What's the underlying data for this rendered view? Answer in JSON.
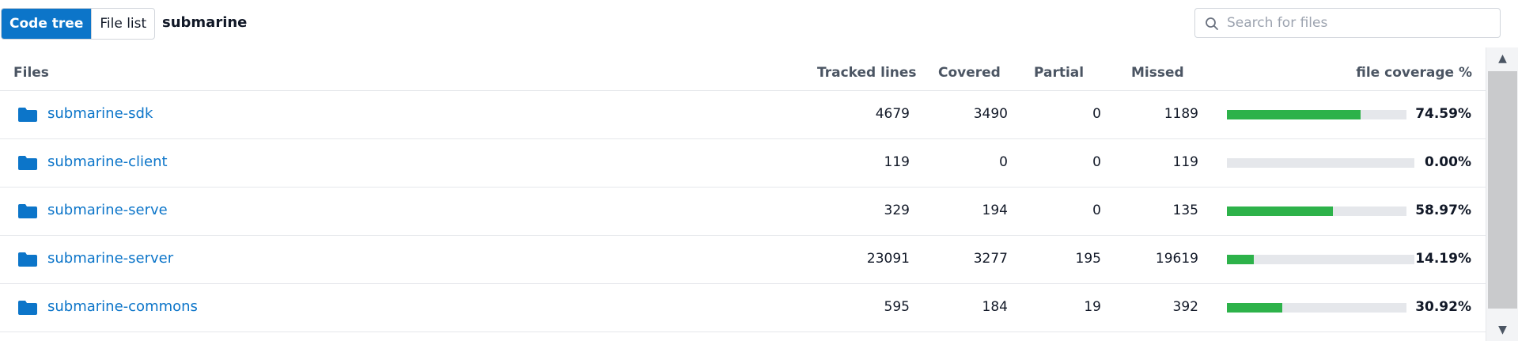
{
  "toolbar": {
    "tabs": [
      {
        "label": "Code tree",
        "active": true
      },
      {
        "label": "File list",
        "active": false
      }
    ],
    "repo_name": "submarine",
    "search": {
      "placeholder": "Search for files",
      "value": ""
    }
  },
  "table": {
    "headers": {
      "files": "Files",
      "tracked": "Tracked lines",
      "covered": "Covered",
      "partial": "Partial",
      "missed": "Missed",
      "coverage": "file coverage %"
    },
    "rows": [
      {
        "name": "submarine-sdk",
        "tracked": "4679",
        "covered": "3490",
        "partial": "0",
        "missed": "1189",
        "coverage": "74.59%",
        "coverage_value": 74.59
      },
      {
        "name": "submarine-client",
        "tracked": "119",
        "covered": "0",
        "partial": "0",
        "missed": "119",
        "coverage": "0.00%",
        "coverage_value": 0.0
      },
      {
        "name": "submarine-serve",
        "tracked": "329",
        "covered": "194",
        "partial": "0",
        "missed": "135",
        "coverage": "58.97%",
        "coverage_value": 58.97
      },
      {
        "name": "submarine-server",
        "tracked": "23091",
        "covered": "3277",
        "partial": "195",
        "missed": "19619",
        "coverage": "14.19%",
        "coverage_value": 14.19
      },
      {
        "name": "submarine-commons",
        "tracked": "595",
        "covered": "184",
        "partial": "19",
        "missed": "392",
        "coverage": "30.92%",
        "coverage_value": 30.92
      }
    ]
  },
  "colors": {
    "accent": "#0c75c9",
    "bar_fill": "#2db24a",
    "bar_track": "#e5e7eb"
  },
  "icons": {
    "search": "search-icon",
    "folder": "folder-icon",
    "scroll_up": "chevron-up-icon",
    "scroll_down": "chevron-down-icon"
  }
}
